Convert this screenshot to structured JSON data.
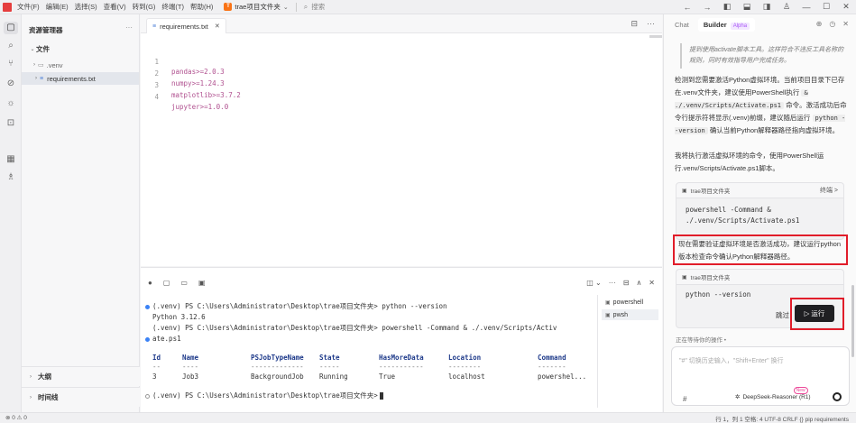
{
  "menu": [
    "文件(F)",
    "编辑(E)",
    "选择(S)",
    "查看(V)",
    "转到(G)",
    "终端(T)",
    "帮助(H)"
  ],
  "project": {
    "badge": "T",
    "name": "trae项目文件夹"
  },
  "search": {
    "placeholder": "搜索"
  },
  "explorer": {
    "title": "资源管理器",
    "files_section": "文件",
    "items": [
      ".venv",
      "requirements.txt"
    ],
    "outline": "大纲",
    "timeline": "时间线"
  },
  "editor": {
    "tab_label": "requirements.txt",
    "lines": [
      {
        "n": "1",
        "text": "pandas>=2.0.3"
      },
      {
        "n": "2",
        "text": "numpy>=1.24.3"
      },
      {
        "n": "3",
        "text": "matplotlib>=3.7.2"
      },
      {
        "n": "4",
        "text": "jupyter>=1.0.0"
      }
    ]
  },
  "terminal": {
    "lines": [
      "(.venv) PS C:\\Users\\Administrator\\Desktop\\trae项目文件夹> python --version",
      "Python 3.12.6",
      "(.venv) PS C:\\Users\\Administrator\\Desktop\\trae项目文件夹> powershell -Command & ./.venv/Scripts/Activ",
      "ate.ps1"
    ],
    "headers": [
      "Id",
      "Name",
      "PSJobTypeName",
      "State",
      "HasMoreData",
      "Location",
      "Command"
    ],
    "dashes": [
      "--",
      "----",
      "-------------",
      "-----",
      "-----------",
      "--------",
      "-------"
    ],
    "row": [
      "3",
      "Job3",
      "BackgroundJob",
      "Running",
      "True",
      "localhost",
      "powershel..."
    ],
    "prompt": "(.venv) PS C:\\Users\\Administrator\\Desktop\\trae项目文件夹>",
    "shells": [
      "powershell",
      "pwsh"
    ]
  },
  "chat": {
    "tab_chat": "Chat",
    "tab_builder": "Builder",
    "alpha": "Alpha",
    "italic_note": "提到使用activate脚本工具。这样符合不违反工具名称的规则，同时有效指导用户完成任务。",
    "para1": "检测到您需要激活Python虚拟环境。当前项目目录下已存在.venv文件夹，建议使用PowerShell执行",
    "para1_code": "& ./.venv/Scripts/Activate.ps1",
    "para1_b": "命令。激活成功后命令行提示符将显示(.venv)前缀，建议随后运行",
    "para1_code2": "python --version",
    "para1_c": "确认当前Python解释器路径指向虚拟环境。",
    "para2": "我将执行激活虚拟环境的命令，使用PowerShell运行.venv/Scripts/Activate.ps1脚本。",
    "card1_title": "trae项目文件夹",
    "card1_action": "终端 >",
    "card1_code": "powershell -Command &\n./.venv/Scripts/Activate.ps1",
    "para3": "现在需要验证虚拟环境是否激活成功，建议运行python版本检查命令确认Python解释器路径。",
    "card2_title": "trae项目文件夹",
    "card2_code": "python --version",
    "skip": "跳过",
    "run": "▷ 运行",
    "waiting": "正在等待你的操作  •",
    "input_placeholder": "\"#\" 切换历史输入，\"Shift+Enter\" 换行",
    "model": "DeepSeek-Reasoner (R1)",
    "new_badge": "New"
  },
  "status": {
    "left": "⊗ 0 ⚠ 0",
    "right": "行 1，列 1   空格: 4   UTF-8   CRLF   {} pip requirements"
  },
  "colors": {
    "accent": "#f97316",
    "highlight_box": "#e11d2a",
    "run_button": "#1f1f22"
  }
}
